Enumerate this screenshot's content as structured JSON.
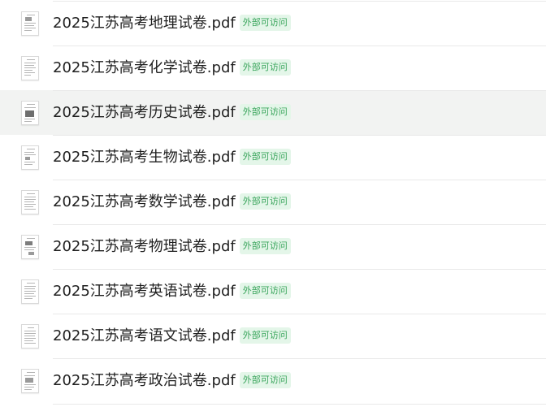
{
  "files": [
    {
      "name": "2025江苏高考地理试卷.pdf",
      "badge": "外部可访问",
      "icon": "pdf-thumbnail-icon"
    },
    {
      "name": "2025江苏高考化学试卷.pdf",
      "badge": "外部可访问",
      "icon": "pdf-thumbnail-icon"
    },
    {
      "name": "2025江苏高考历史试卷.pdf",
      "badge": "外部可访问",
      "icon": "pdf-thumbnail-icon"
    },
    {
      "name": "2025江苏高考生物试卷.pdf",
      "badge": "外部可访问",
      "icon": "pdf-thumbnail-icon"
    },
    {
      "name": "2025江苏高考数学试卷.pdf",
      "badge": "外部可访问",
      "icon": "pdf-thumbnail-icon"
    },
    {
      "name": "2025江苏高考物理试卷.pdf",
      "badge": "外部可访问",
      "icon": "pdf-thumbnail-icon"
    },
    {
      "name": "2025江苏高考英语试卷.pdf",
      "badge": "外部可访问",
      "icon": "pdf-thumbnail-icon"
    },
    {
      "name": "2025江苏高考语文试卷.pdf",
      "badge": "外部可访问",
      "icon": "pdf-thumbnail-icon"
    },
    {
      "name": "2025江苏高考政治试卷.pdf",
      "badge": "外部可访问",
      "icon": "pdf-thumbnail-icon"
    }
  ],
  "colors": {
    "badge_text": "#3aa55c",
    "badge_bg": "#e4f6e9",
    "hover_row_bg": "#f2f3f2",
    "divider": "#e9e9e9"
  }
}
